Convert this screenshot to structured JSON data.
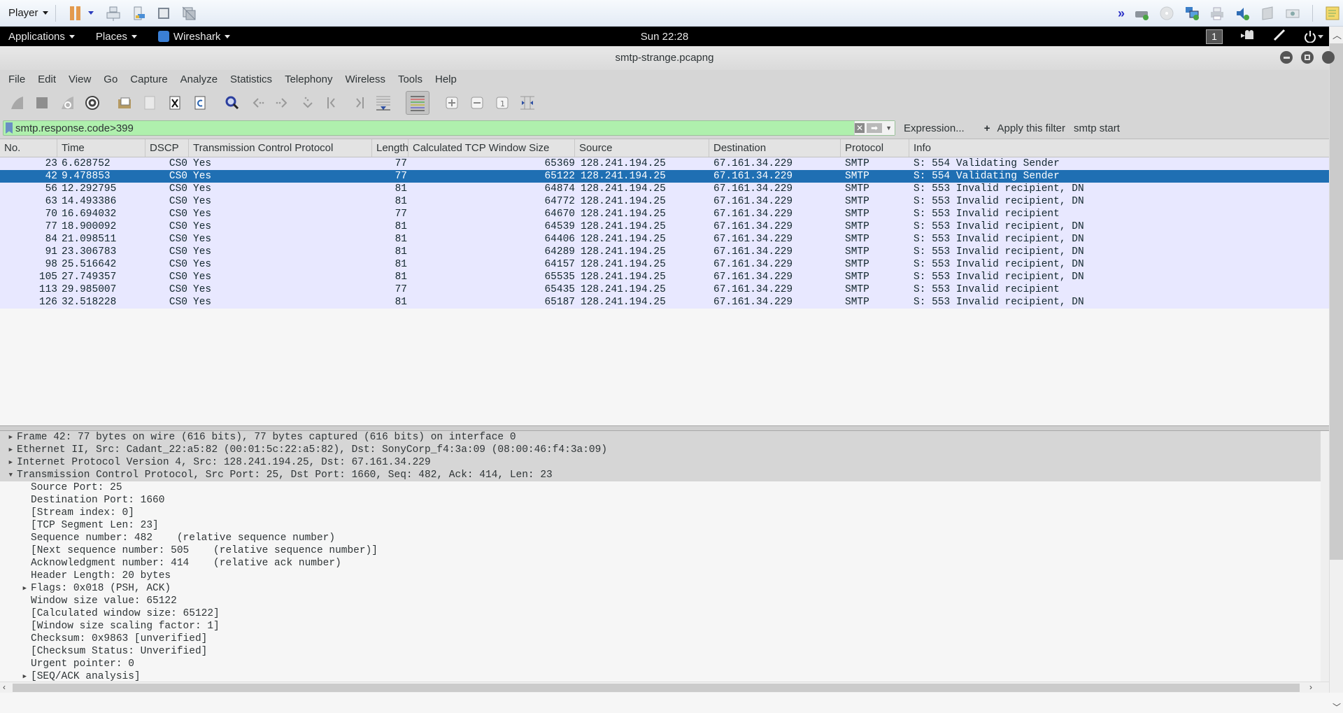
{
  "vm_toolbar": {
    "player_label": "Player",
    "icons": [
      "pause-icon",
      "send-ctrl-alt-del-icon",
      "removable-devices-icon",
      "fullscreen-icon",
      "unity-icon"
    ],
    "status_icons": [
      "more-chevron-icon",
      "hard-disk-icon",
      "cd-icon",
      "network-icon",
      "printer-icon",
      "sound-icon",
      "floppy-icon",
      "camera-icon",
      "notes-icon"
    ]
  },
  "gnome_bar": {
    "applications": "Applications",
    "places": "Places",
    "app": "Wireshark",
    "clock": "Sun 22:28",
    "workspace": "1"
  },
  "window": {
    "title": "smtp-strange.pcapng"
  },
  "menu": [
    "File",
    "Edit",
    "View",
    "Go",
    "Capture",
    "Analyze",
    "Statistics",
    "Telephony",
    "Wireless",
    "Tools",
    "Help"
  ],
  "toolbar": {
    "buttons": [
      "start-capture",
      "stop-capture",
      "restart-capture",
      "capture-options",
      "open-file",
      "save-file",
      "close-file",
      "reload-file",
      "find-packet",
      "go-back",
      "go-forward",
      "go-to-packet",
      "go-first",
      "go-last",
      "autoscroll",
      "colorize",
      "zoom-in",
      "zoom-out",
      "normal-size",
      "resize-columns"
    ]
  },
  "filter": {
    "value": "smtp.response.code>399",
    "expression_label": "Expression...",
    "plus_label": "+",
    "apply_label": "Apply this filter",
    "saved_filter_label": "smtp start"
  },
  "packet_list": {
    "columns": [
      "No.",
      "Time",
      "DSCP",
      "Transmission Control Protocol",
      "Length",
      "Calculated TCP Window Size",
      "Source",
      "Destination",
      "Protocol",
      "Info"
    ],
    "selected_index": 1,
    "rows": [
      {
        "no": "23",
        "time": "6.628752",
        "dscp": "CS0",
        "tcp": "Yes",
        "len": "77",
        "win": "65369",
        "src": "128.241.194.25",
        "dst": "67.161.34.229",
        "proto": "SMTP",
        "info": "S: 554 Validating Sender"
      },
      {
        "no": "42",
        "time": "9.478853",
        "dscp": "CS0",
        "tcp": "Yes",
        "len": "77",
        "win": "65122",
        "src": "128.241.194.25",
        "dst": "67.161.34.229",
        "proto": "SMTP",
        "info": "S: 554 Validating Sender"
      },
      {
        "no": "56",
        "time": "12.292795",
        "dscp": "CS0",
        "tcp": "Yes",
        "len": "81",
        "win": "64874",
        "src": "128.241.194.25",
        "dst": "67.161.34.229",
        "proto": "SMTP",
        "info": "S: 553 Invalid recipient, DN"
      },
      {
        "no": "63",
        "time": "14.493386",
        "dscp": "CS0",
        "tcp": "Yes",
        "len": "81",
        "win": "64772",
        "src": "128.241.194.25",
        "dst": "67.161.34.229",
        "proto": "SMTP",
        "info": "S: 553 Invalid recipient, DN"
      },
      {
        "no": "70",
        "time": "16.694032",
        "dscp": "CS0",
        "tcp": "Yes",
        "len": "77",
        "win": "64670",
        "src": "128.241.194.25",
        "dst": "67.161.34.229",
        "proto": "SMTP",
        "info": "S: 553 Invalid recipient"
      },
      {
        "no": "77",
        "time": "18.900092",
        "dscp": "CS0",
        "tcp": "Yes",
        "len": "81",
        "win": "64539",
        "src": "128.241.194.25",
        "dst": "67.161.34.229",
        "proto": "SMTP",
        "info": "S: 553 Invalid recipient, DN"
      },
      {
        "no": "84",
        "time": "21.098511",
        "dscp": "CS0",
        "tcp": "Yes",
        "len": "81",
        "win": "64406",
        "src": "128.241.194.25",
        "dst": "67.161.34.229",
        "proto": "SMTP",
        "info": "S: 553 Invalid recipient, DN"
      },
      {
        "no": "91",
        "time": "23.306783",
        "dscp": "CS0",
        "tcp": "Yes",
        "len": "81",
        "win": "64289",
        "src": "128.241.194.25",
        "dst": "67.161.34.229",
        "proto": "SMTP",
        "info": "S: 553 Invalid recipient, DN"
      },
      {
        "no": "98",
        "time": "25.516642",
        "dscp": "CS0",
        "tcp": "Yes",
        "len": "81",
        "win": "64157",
        "src": "128.241.194.25",
        "dst": "67.161.34.229",
        "proto": "SMTP",
        "info": "S: 553 Invalid recipient, DN"
      },
      {
        "no": "105",
        "time": "27.749357",
        "dscp": "CS0",
        "tcp": "Yes",
        "len": "81",
        "win": "65535",
        "src": "128.241.194.25",
        "dst": "67.161.34.229",
        "proto": "SMTP",
        "info": "S: 553 Invalid recipient, DN"
      },
      {
        "no": "113",
        "time": "29.985007",
        "dscp": "CS0",
        "tcp": "Yes",
        "len": "77",
        "win": "65435",
        "src": "128.241.194.25",
        "dst": "67.161.34.229",
        "proto": "SMTP",
        "info": "S: 553 Invalid recipient"
      },
      {
        "no": "126",
        "time": "32.518228",
        "dscp": "CS0",
        "tcp": "Yes",
        "len": "81",
        "win": "65187",
        "src": "128.241.194.25",
        "dst": "67.161.34.229",
        "proto": "SMTP",
        "info": "S: 553 Invalid recipient, DN"
      }
    ]
  },
  "details": {
    "top_level": [
      {
        "text": "Frame 42: 77 bytes on wire (616 bits), 77 bytes captured (616 bits) on interface 0",
        "expanded": false
      },
      {
        "text": "Ethernet II, Src: Cadant_22:a5:82 (00:01:5c:22:a5:82), Dst: SonyCorp_f4:3a:09 (08:00:46:f4:3a:09)",
        "expanded": false
      },
      {
        "text": "Internet Protocol Version 4, Src: 128.241.194.25, Dst: 67.161.34.229",
        "expanded": false
      },
      {
        "text": "Transmission Control Protocol, Src Port: 25, Dst Port: 1660, Seq: 482, Ack: 414, Len: 23",
        "expanded": true
      }
    ],
    "tcp_fields": [
      {
        "text": "Source Port: 25",
        "expandable": false
      },
      {
        "text": "Destination Port: 1660",
        "expandable": false
      },
      {
        "text": "[Stream index: 0]",
        "expandable": false
      },
      {
        "text": "[TCP Segment Len: 23]",
        "expandable": false
      },
      {
        "text": "Sequence number: 482    (relative sequence number)",
        "expandable": false
      },
      {
        "text": "[Next sequence number: 505    (relative sequence number)]",
        "expandable": false
      },
      {
        "text": "Acknowledgment number: 414    (relative ack number)",
        "expandable": false
      },
      {
        "text": "Header Length: 20 bytes",
        "expandable": false
      },
      {
        "text": "Flags: 0x018 (PSH, ACK)",
        "expandable": true
      },
      {
        "text": "Window size value: 65122",
        "expandable": false
      },
      {
        "text": "[Calculated window size: 65122]",
        "expandable": false
      },
      {
        "text": "[Window size scaling factor: 1]",
        "expandable": false
      },
      {
        "text": "Checksum: 0x9863 [unverified]",
        "expandable": false
      },
      {
        "text": "[Checksum Status: Unverified]",
        "expandable": false
      },
      {
        "text": "Urgent pointer: 0",
        "expandable": false
      },
      {
        "text": "[SEQ/ACK analysis]",
        "expandable": true
      }
    ]
  },
  "colors": {
    "filter_valid_bg": "#aff0ad",
    "row_bg": "#e8e8ff",
    "row_selected_bg": "#1f6fb3"
  }
}
